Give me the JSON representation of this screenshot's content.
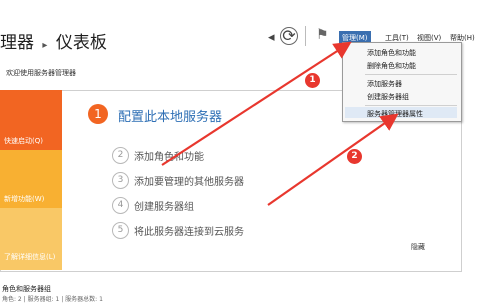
{
  "header": {
    "title_prefix": "理器",
    "separator": "▸",
    "title": "仪表板",
    "back_icon": "◂",
    "refresh_icon": "⟳",
    "flag_icon": "⚑"
  },
  "menu": {
    "manage": "管理(M)",
    "tools": "工具(T)",
    "view": "视图(V)",
    "help": "帮助(H)"
  },
  "dropdown": {
    "items": [
      "添加角色和功能",
      "删除角色和功能",
      "添加服务器",
      "创建服务器组",
      "服务器管理器属性"
    ]
  },
  "welcome": "欢迎使用服务器管理器",
  "tiles": {
    "quick_start": "快速启动(Q)",
    "whats_new": "新增功能(W)",
    "learn_more": "了解详细信息(L)"
  },
  "steps": {
    "main_num": "1",
    "main_label": "配置此本地服务器",
    "items": [
      {
        "num": "2",
        "label": "添加角色和功能"
      },
      {
        "num": "3",
        "label": "添加要管理的其他服务器"
      },
      {
        "num": "4",
        "label": "创建服务器组"
      },
      {
        "num": "5",
        "label": "将此服务器连接到云服务"
      }
    ]
  },
  "hide_label": "隐藏",
  "roles": {
    "title": "角色和服务器组",
    "subtitle": "角色: 2 | 服务器组: 1 | 服务器总数: 1"
  },
  "annotations": {
    "badge1": "1",
    "badge2": "2"
  },
  "colors": {
    "orange": "#f26522",
    "yellow": "#f8b032",
    "arrow_red": "#e8372e",
    "link_blue": "#2e6fb5"
  }
}
